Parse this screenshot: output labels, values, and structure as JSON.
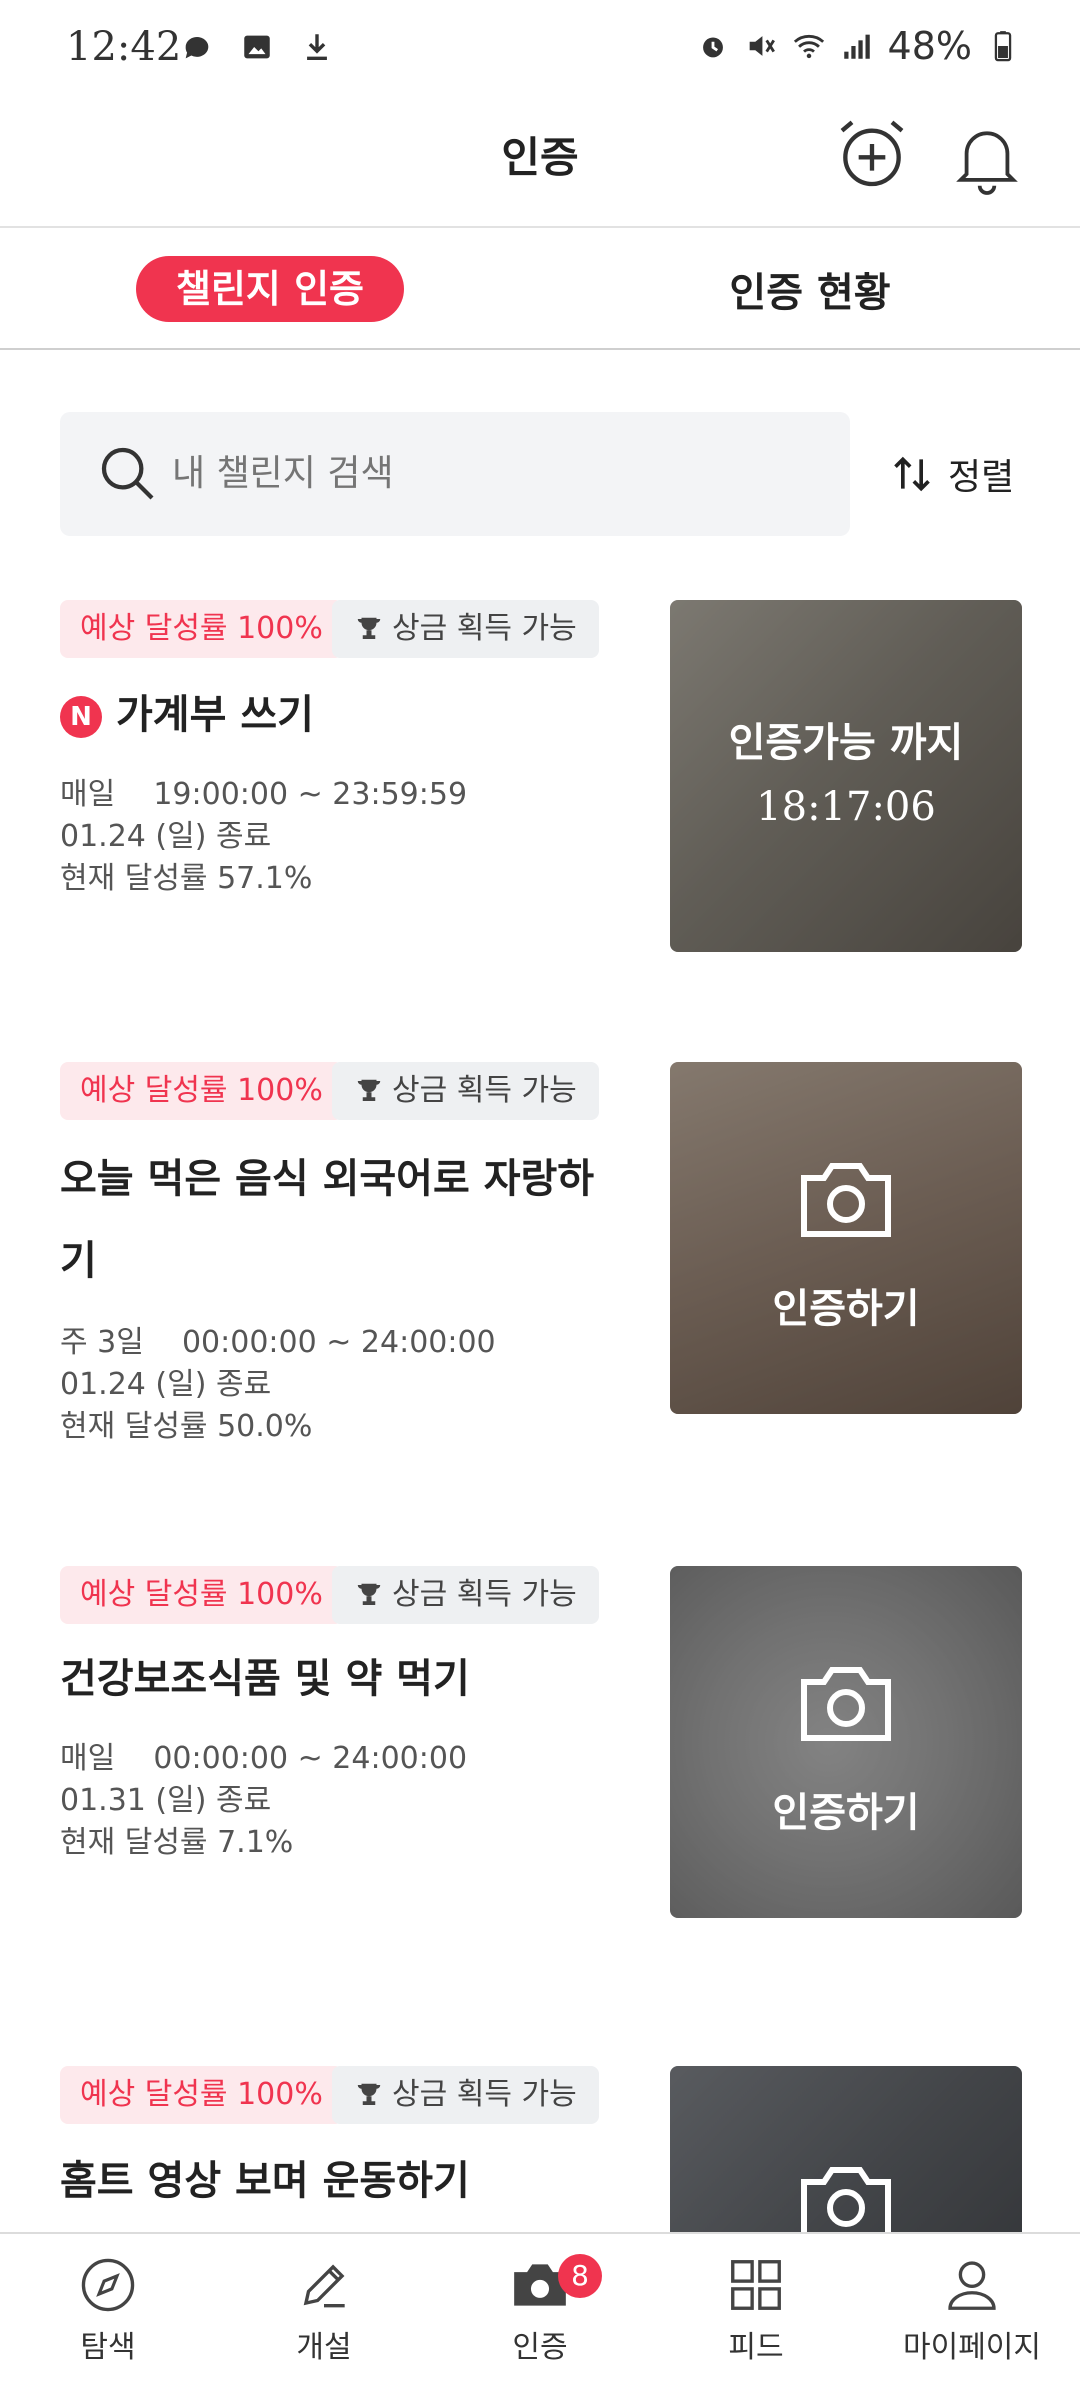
{
  "status_bar": {
    "time": "12:42",
    "battery": "48%",
    "left_icons": [
      "chat-bubble-icon",
      "image-icon",
      "download-icon"
    ],
    "right_icons": [
      "alarm-icon",
      "mute-icon",
      "wifi-icon",
      "signal-icon",
      "battery-icon"
    ]
  },
  "app_bar": {
    "title": "인증",
    "actions": [
      "alarm-add-icon",
      "bell-icon"
    ]
  },
  "tabs": [
    {
      "label": "챌린지 인증",
      "active": true
    },
    {
      "label": "인증 현황",
      "active": false
    }
  ],
  "search": {
    "placeholder": "내 챌린지 검색",
    "sort_label": "정렬"
  },
  "challenges": [
    {
      "rate_badge": "예상 달성률 100%",
      "prize_badge": "상금 획득 가능",
      "new": "N",
      "title": "가계부 쓰기",
      "schedule": "매일    19:00:00 ~ 23:59:59",
      "end_date": "01.24 (일) 종료",
      "progress": "현재 달성률 57.1%",
      "thumb_line1": "인증가능 까지",
      "thumb_line2": "18:17:06",
      "thumb_colors": [
        "#8a8478",
        "#5e574d",
        "#b9b3a6"
      ]
    },
    {
      "rate_badge": "예상 달성률 100%",
      "prize_badge": "상금 획득 가능",
      "title": "오늘 먹은 음식 외국어로 자랑하기",
      "schedule": "주 3일    00:00:00 ~ 24:00:00",
      "end_date": "01.24 (일) 종료",
      "progress": "현재 달성률 50.0%",
      "thumb_label": "인증하기",
      "thumb_colors": [
        "#9a8270",
        "#6c5646",
        "#c7b3a0"
      ]
    },
    {
      "rate_badge": "예상 달성률 100%",
      "prize_badge": "상금 획득 가능",
      "title": "건강보조식품 및 약  먹기",
      "schedule": "매일    00:00:00 ~ 24:00:00",
      "end_date": "01.31 (일) 종료",
      "progress": "현재 달성률 7.1%",
      "thumb_label": "인증하기",
      "thumb_colors": [
        "#a7a7a7",
        "#7d7d7d",
        "#c4c4c4"
      ]
    },
    {
      "rate_badge": "예상 달성률 100%",
      "prize_badge": "상금 획득 가능",
      "title": "홈트 영상 보며 운동하기",
      "thumb_colors": [
        "#55595f",
        "#2f3238",
        "#7c8087"
      ]
    }
  ],
  "bottom_nav": [
    {
      "label": "탐색",
      "icon": "compass-icon"
    },
    {
      "label": "개설",
      "icon": "pencil-icon"
    },
    {
      "label": "인증",
      "icon": "camera-icon",
      "badge": "8",
      "active": true
    },
    {
      "label": "피드",
      "icon": "grid-icon"
    },
    {
      "label": "마이페이지",
      "icon": "user-icon"
    }
  ],
  "colors": {
    "accent": "#f0344f",
    "badge_rate_bg": "#fde9ec",
    "badge_prize_bg": "#eef0f2",
    "search_bg": "#f3f4f6"
  }
}
